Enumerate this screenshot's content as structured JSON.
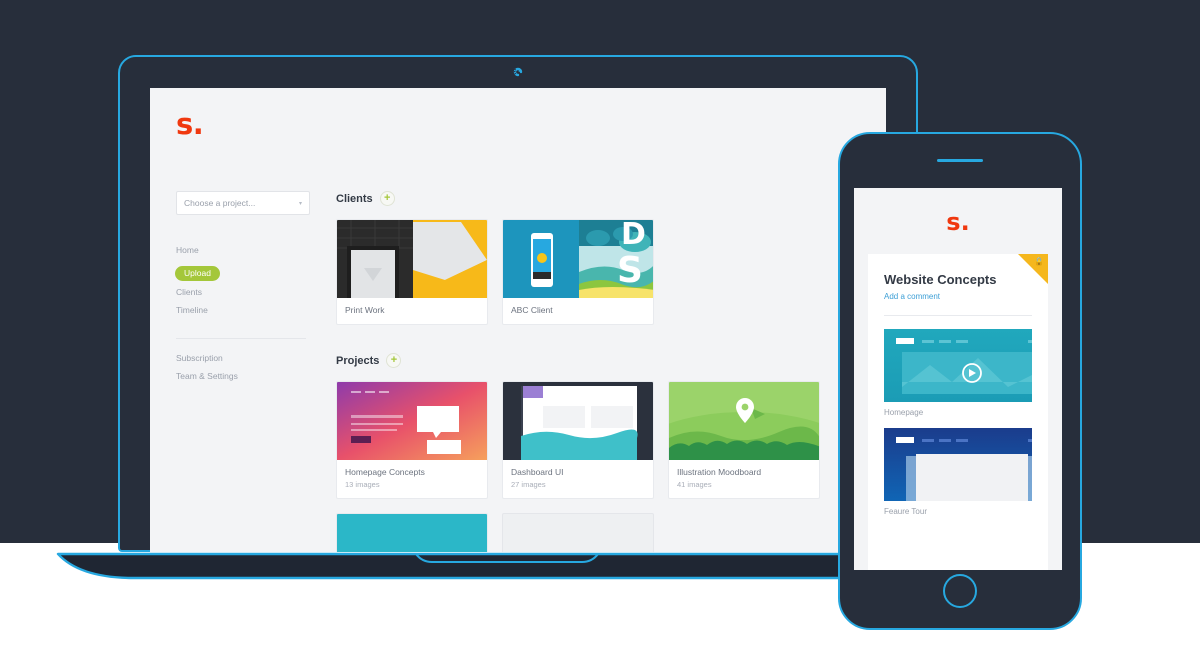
{
  "brand": {
    "logo_text": "s.",
    "logo_color": "#f0380f",
    "accent": "#27a8e0",
    "green": "#a4c73a"
  },
  "laptop": {
    "camera_icon": "spinner-icon",
    "app": {
      "logo_text": "s.",
      "sidebar": {
        "select": {
          "value": "Choose a project...",
          "chevron": "▾"
        },
        "nav_primary": [
          {
            "label": "Home",
            "active": false
          },
          {
            "label": "Upload",
            "active": true
          },
          {
            "label": "Clients",
            "active": false
          },
          {
            "label": "Timeline",
            "active": false
          }
        ],
        "nav_secondary": [
          {
            "label": "Subscription"
          },
          {
            "label": "Team & Settings"
          }
        ]
      },
      "sections": [
        {
          "title": "Clients",
          "add_label": "+",
          "cards": [
            {
              "title": "Print Work",
              "sub": "",
              "thumb": "print-work"
            },
            {
              "title": "ABC Client",
              "sub": "",
              "thumb": "abc-client"
            }
          ]
        },
        {
          "title": "Projects",
          "add_label": "+",
          "cards": [
            {
              "title": "Homepage Concepts",
              "sub": "13 images",
              "thumb": "homepage-concepts"
            },
            {
              "title": "Dashboard UI",
              "sub": "27 images",
              "thumb": "dashboard-ui"
            },
            {
              "title": "Illustration Moodboard",
              "sub": "41 images",
              "thumb": "illustration-moodboard"
            }
          ]
        }
      ]
    }
  },
  "phone": {
    "logo_text": "s.",
    "ribbon_icon": "lock-icon",
    "title": "Website Concepts",
    "comment_link": "Add a comment",
    "items": [
      {
        "caption": "Homepage",
        "thumb": "homepage-video"
      },
      {
        "caption": "Feaure Tour",
        "thumb": "feature-tour"
      }
    ]
  }
}
